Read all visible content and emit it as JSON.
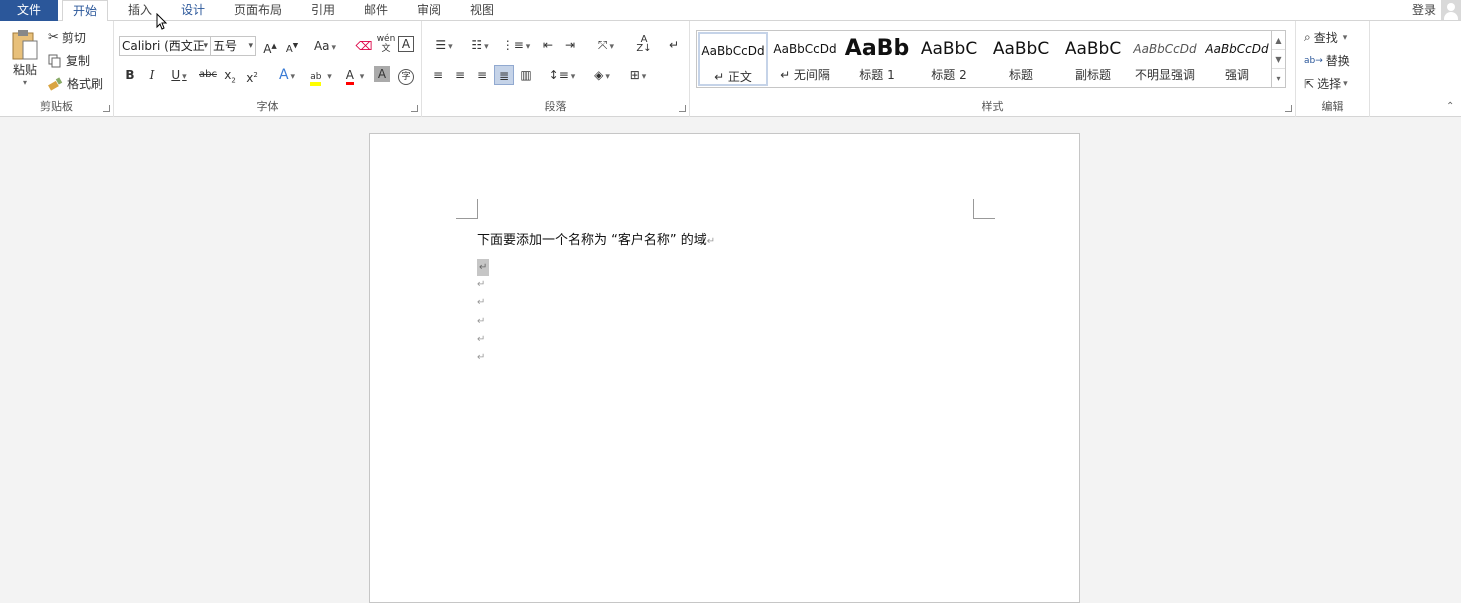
{
  "tabs": {
    "file": "文件",
    "home": "开始",
    "insert": "插入",
    "design": "设计",
    "layout": "页面布局",
    "references": "引用",
    "mailings": "邮件",
    "review": "审阅",
    "view": "视图",
    "login": "登录"
  },
  "clipboard": {
    "paste": "粘贴",
    "cut": "剪切",
    "copy": "复制",
    "format_painter": "格式刷",
    "label": "剪贴板"
  },
  "font": {
    "name": "Calibri (西文正",
    "size": "五号",
    "change_case": "Aa",
    "wen": "wén",
    "label": "字体"
  },
  "paragraph": {
    "label": "段落"
  },
  "styles": {
    "label": "样式",
    "items": [
      {
        "preview": "AaBbCcDd",
        "name": "↵ 正文"
      },
      {
        "preview": "AaBbCcDd",
        "name": "↵ 无间隔"
      },
      {
        "preview": "AaBb",
        "name": "标题 1"
      },
      {
        "preview": "AaBbC",
        "name": "标题 2"
      },
      {
        "preview": "AaBbC",
        "name": "标题"
      },
      {
        "preview": "AaBbC",
        "name": "副标题"
      },
      {
        "preview": "AaBbCcDd",
        "name": "不明显强调"
      },
      {
        "preview": "AaBbCcDd",
        "name": "强调"
      }
    ]
  },
  "editing": {
    "find": "查找",
    "replace": "替换",
    "select": "选择",
    "label": "编辑"
  },
  "document": {
    "line1": "下面要添加一个名称为 “客户名称” 的域",
    "para_mark": "↵"
  },
  "colors": {
    "accent": "#2b579a",
    "highlight": "#ffff00",
    "font_color": "#ff0000"
  }
}
